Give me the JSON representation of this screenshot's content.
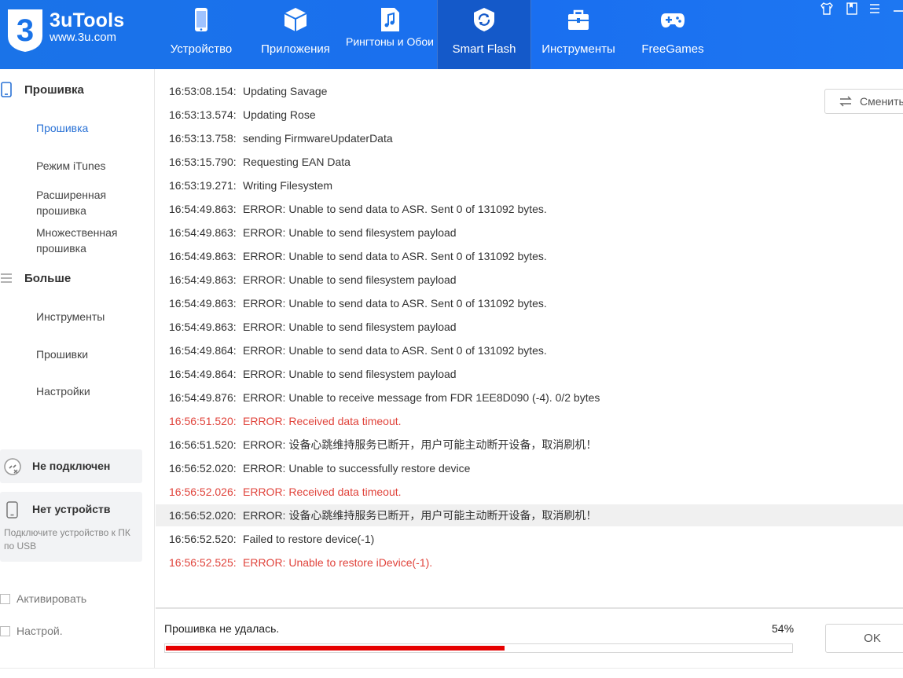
{
  "app": {
    "name": "3uTools",
    "url": "www.3u.com",
    "brand_color": "#1a73e8"
  },
  "nav": {
    "items": [
      {
        "label": "Устройство",
        "icon": "phone-icon"
      },
      {
        "label": "Приложения",
        "icon": "cube-icon"
      },
      {
        "label": "Рингтоны и Обои",
        "icon": "music-file-icon"
      },
      {
        "label": "Smart Flash",
        "icon": "flash-refresh-icon",
        "active": true
      },
      {
        "label": "Инструменты",
        "icon": "toolbox-icon"
      },
      {
        "label": "FreeGames",
        "icon": "gamepad-icon"
      }
    ]
  },
  "sidebar": {
    "flash_section": {
      "title": "Прошивка",
      "items": [
        "Прошивка",
        "Режим iTunes",
        "Расширенная прошивка",
        "Множественная прошивка"
      ]
    },
    "more_section": {
      "title": "Больше",
      "items": [
        "Инструменты",
        "Прошивки",
        "Настройки"
      ]
    },
    "connection_status": "Не подключен",
    "device_status": {
      "title": "Нет устройств",
      "hint": "Подключите устройство к ПК по USB"
    },
    "checkboxes": [
      "Активировать",
      "Настрой."
    ]
  },
  "switch_button": "Сменить",
  "log": [
    {
      "time": "16:53:08.154:",
      "msg": "Updating Savage",
      "type": "normal"
    },
    {
      "time": "16:53:13.574:",
      "msg": "Updating Rose",
      "type": "normal"
    },
    {
      "time": "16:53:13.758:",
      "msg": "sending FirmwareUpdaterData",
      "type": "normal"
    },
    {
      "time": "16:53:15.790:",
      "msg": "Requesting EAN Data",
      "type": "normal"
    },
    {
      "time": "16:53:19.271:",
      "msg": "Writing Filesystem",
      "type": "normal"
    },
    {
      "time": "16:54:49.863:",
      "msg": "ERROR: Unable to send data to ASR. Sent 0 of 131092 bytes.",
      "type": "normal"
    },
    {
      "time": "16:54:49.863:",
      "msg": "ERROR: Unable to send filesystem payload",
      "type": "normal"
    },
    {
      "time": "16:54:49.863:",
      "msg": "ERROR: Unable to send data to ASR. Sent 0 of 131092 bytes.",
      "type": "normal"
    },
    {
      "time": "16:54:49.863:",
      "msg": "ERROR: Unable to send filesystem payload",
      "type": "normal"
    },
    {
      "time": "16:54:49.863:",
      "msg": "ERROR: Unable to send data to ASR. Sent 0 of 131092 bytes.",
      "type": "normal"
    },
    {
      "time": "16:54:49.863:",
      "msg": "ERROR: Unable to send filesystem payload",
      "type": "normal"
    },
    {
      "time": "16:54:49.864:",
      "msg": "ERROR: Unable to send data to ASR. Sent 0 of 131092 bytes.",
      "type": "normal"
    },
    {
      "time": "16:54:49.864:",
      "msg": "ERROR: Unable to send filesystem payload",
      "type": "normal"
    },
    {
      "time": "16:54:49.876:",
      "msg": "ERROR: Unable to receive message from FDR 1EE8D090 (-4). 0/2 bytes",
      "type": "normal"
    },
    {
      "time": "16:56:51.520:",
      "msg": "ERROR: Received data timeout.",
      "type": "error"
    },
    {
      "time": "16:56:51.520:",
      "msg": "ERROR: 设备心跳维持服务已断开，用户可能主动断开设备，取消刷机！",
      "type": "normal"
    },
    {
      "time": "16:56:52.020:",
      "msg": "ERROR: Unable to successfully restore device",
      "type": "normal"
    },
    {
      "time": "16:56:52.026:",
      "msg": "ERROR: Received data timeout.",
      "type": "error"
    },
    {
      "time": "16:56:52.020:",
      "msg": "ERROR: 设备心跳维持服务已断开，用户可能主动断开设备，取消刷机！",
      "type": "highlight"
    },
    {
      "time": "16:56:52.520:",
      "msg": "Failed to restore device(-1)",
      "type": "normal"
    },
    {
      "time": "16:56:52.525:",
      "msg": "ERROR: Unable to restore iDevice(-1).",
      "type": "error"
    }
  ],
  "progress": {
    "status": "Прошивка не удалась.",
    "percent_label": "54%",
    "fraction": 0.54,
    "bar_color": "#e60000"
  },
  "ok_button": "OK"
}
